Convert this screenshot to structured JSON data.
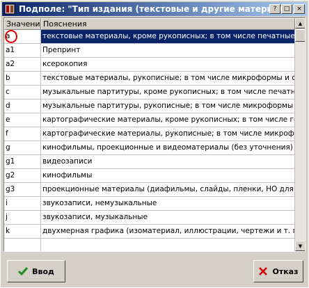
{
  "window": {
    "title": "Подполе: \"Тип издания (текстовые и другие материалы)\""
  },
  "titlebar_buttons": {
    "help": "?",
    "maximize": "□",
    "close": "×"
  },
  "table": {
    "headers": [
      "Значение",
      "Пояснения"
    ],
    "rows": [
      {
        "code": "a",
        "desc": "текстовые материалы, кроме рукописных;  в  том числе печатные тексты"
      },
      {
        "code": "a1",
        "desc": "Препринт"
      },
      {
        "code": "a2",
        "desc": "ксерокопия"
      },
      {
        "code": "b",
        "desc": "текстовые материалы, рукописные;  в  том числе микроформы и оцифрованные"
      },
      {
        "code": "c",
        "desc": "музыкальные партитуры, кроме рукописных;  в  том числе печатные музыкальные"
      },
      {
        "code": "d",
        "desc": "музыкальные партитуры, рукописные;  в  том числе микроформы и оцифрованные"
      },
      {
        "code": "e",
        "desc": "картографические материалы, кроме рукописных;  в  том числе географические"
      },
      {
        "code": "f",
        "desc": "картографические материалы, рукописные;  в  том числе микроформы"
      },
      {
        "code": "g",
        "desc": "кинофильмы, проекционные и видеоматериалы (без уточнения)"
      },
      {
        "code": "g1",
        "desc": "видеозаписи"
      },
      {
        "code": "g2",
        "desc": "кинофильмы"
      },
      {
        "code": "g3",
        "desc": "проекционные материалы (диафильмы, слайды, пленки, НО для непрозрачных"
      },
      {
        "code": "i",
        "desc": "звукозаписи, немузыкальные"
      },
      {
        "code": "j",
        "desc": "звукозаписи, музыкальные"
      },
      {
        "code": "k",
        "desc": "двухмерная графика (изоматериал, иллюстрации, чертежи и т. п.-графика)"
      },
      {
        "code": "",
        "desc": ""
      }
    ]
  },
  "buttons": {
    "ok": "Ввод",
    "cancel": "Отказ"
  }
}
